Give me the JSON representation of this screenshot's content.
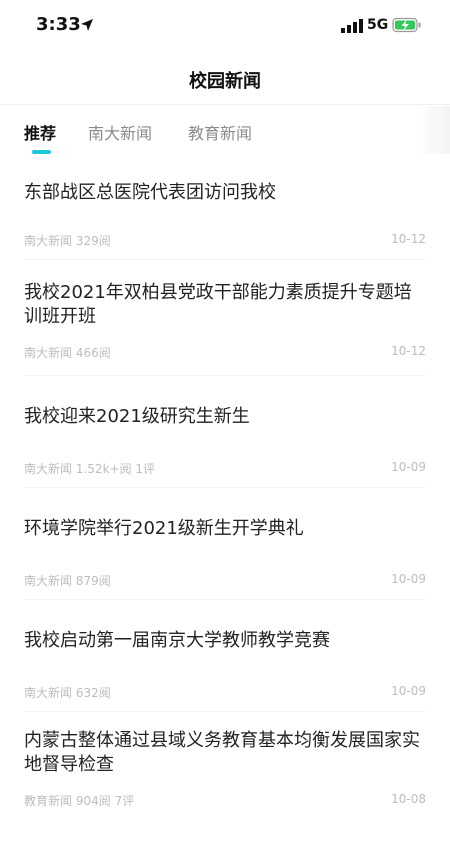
{
  "status_bar": {
    "time": "3:33",
    "network": "5G",
    "icons": [
      "location-arrow-icon",
      "signal-bars-icon",
      "battery-charging-icon"
    ]
  },
  "header": {
    "title": "校园新闻"
  },
  "tabs": [
    {
      "label": "推荐",
      "active": true
    },
    {
      "label": "南大新闻",
      "active": false
    },
    {
      "label": "教育新闻",
      "active": false
    }
  ],
  "colors": {
    "accent": "#1ec8d6",
    "battery": "#34c759",
    "meta_text": "#bdbdbd",
    "inactive_tab": "#8a8a8a"
  },
  "news": [
    {
      "title": "东部战区总医院代表团访问我校",
      "source": "南大新闻",
      "stats": "329阅",
      "date": "10-12"
    },
    {
      "title": "我校2021年双柏县党政干部能力素质提升专题培训班开班",
      "source": "南大新闻",
      "stats": "466阅",
      "date": "10-12"
    },
    {
      "title": "我校迎来2021级研究生新生",
      "source": "南大新闻",
      "stats": "1.52k+阅 1评",
      "date": "10-09"
    },
    {
      "title": "环境学院举行2021级新生开学典礼",
      "source": "南大新闻",
      "stats": "879阅",
      "date": "10-09"
    },
    {
      "title": "我校启动第一届南京大学教师教学竞赛",
      "source": "南大新闻",
      "stats": "632阅",
      "date": "10-09"
    },
    {
      "title": "内蒙古整体通过县域义务教育基本均衡发展国家实地督导检查",
      "source": "教育新闻",
      "stats": "904阅 7评",
      "date": "10-08"
    }
  ]
}
